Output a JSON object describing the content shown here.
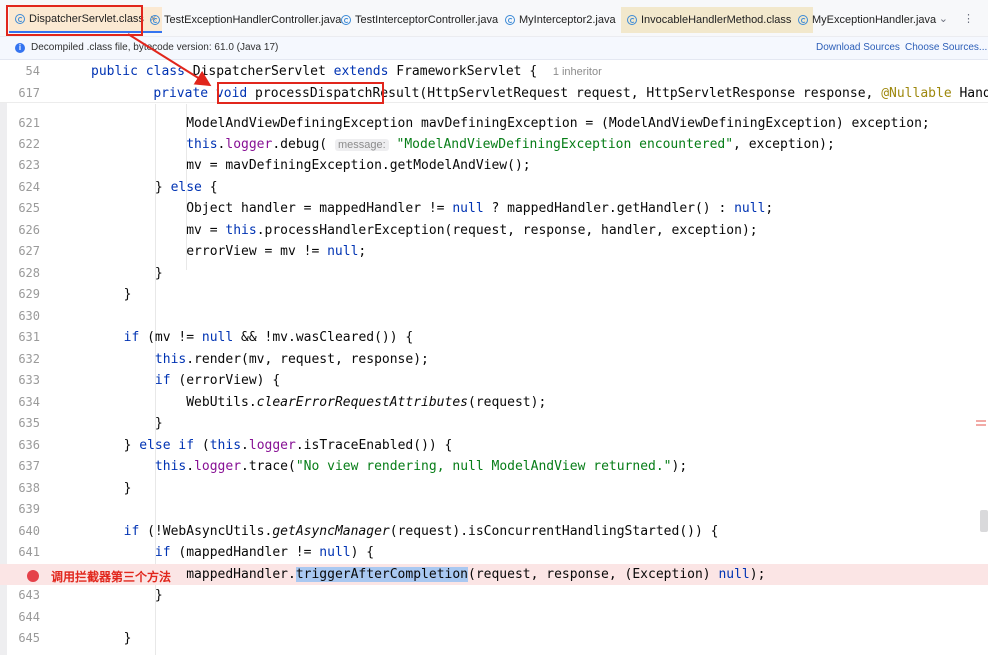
{
  "tabs": [
    {
      "label": "DispatcherServlet.class",
      "active": true,
      "close": "×"
    },
    {
      "label": "TestExceptionHandlerController.java"
    },
    {
      "label": "TestInterceptorController.java"
    },
    {
      "label": "MyInterceptor2.java"
    },
    {
      "label": "InvocableHandlerMethod.class"
    },
    {
      "label": "MyExceptionHandler.java"
    }
  ],
  "tab_menu": "⌄ ⋮",
  "banner": {
    "message": "Decompiled .class file, bytecode version: 61.0 (Java 17)",
    "download_sources": "Download Sources",
    "choose_sources": "Choose Sources..."
  },
  "sticky_lines": [
    {
      "num": "54",
      "hint": "1 inheritor"
    },
    {
      "num": "617"
    }
  ],
  "code_lines": [
    {
      "num": "621"
    },
    {
      "num": "622"
    },
    {
      "num": "623"
    },
    {
      "num": "624"
    },
    {
      "num": "625"
    },
    {
      "num": "626"
    },
    {
      "num": "627"
    },
    {
      "num": "628"
    },
    {
      "num": "629"
    },
    {
      "num": "630"
    },
    {
      "num": "631"
    },
    {
      "num": "632"
    },
    {
      "num": "633"
    },
    {
      "num": "634"
    },
    {
      "num": "635"
    },
    {
      "num": "636"
    },
    {
      "num": "637"
    },
    {
      "num": "638"
    },
    {
      "num": "639"
    },
    {
      "num": "640"
    },
    {
      "num": "641"
    },
    {
      "num": ""
    },
    {
      "num": "643"
    },
    {
      "num": "644"
    },
    {
      "num": "645"
    }
  ],
  "inlay_hint": "message:",
  "annotation_label": "调用拦截器第三个方法",
  "colors": {
    "keyword": "#0033b3",
    "string": "#067d17",
    "field": "#871094",
    "annotation_box": "#e1261c",
    "breakpoint": "#e5414a",
    "breakpoint_line_bg": "#fbe5e5",
    "selection": "#a9c8f1"
  }
}
